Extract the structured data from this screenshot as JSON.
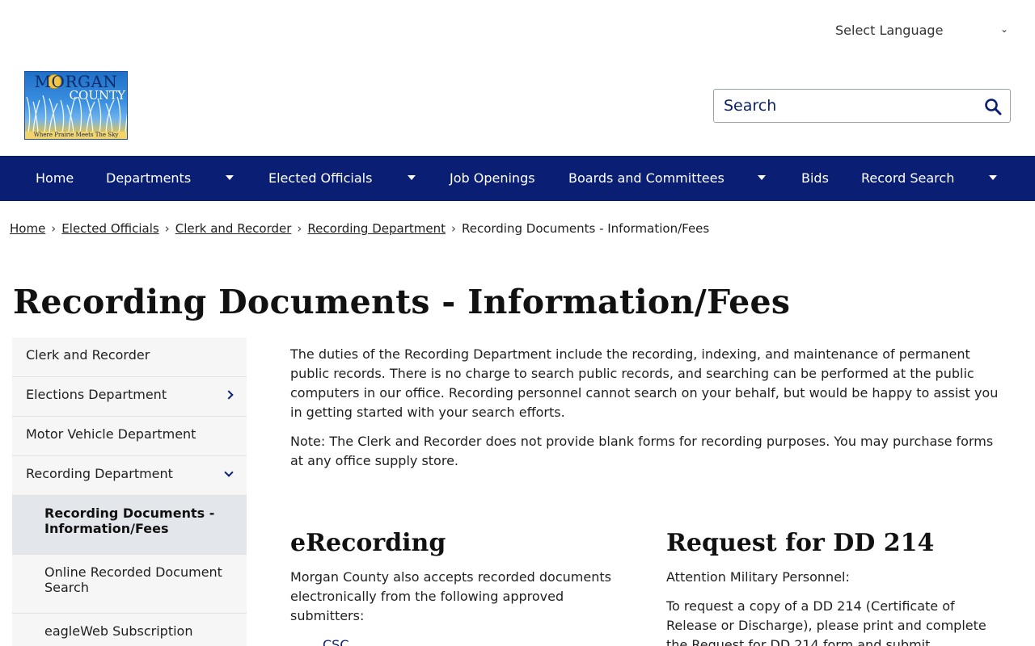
{
  "language_select": {
    "label": "Select Language"
  },
  "logo": {
    "line1": "MORGAN",
    "line2": "COUNTY",
    "tagline": "Where Prairie Meets The Sky"
  },
  "search": {
    "placeholder": "Search"
  },
  "nav": {
    "items": [
      {
        "label": "Home"
      },
      {
        "label": "Departments"
      },
      {
        "label": "Elected Officials"
      },
      {
        "label": "Job Openings"
      },
      {
        "label": "Boards and Committees"
      },
      {
        "label": "Bids"
      },
      {
        "label": "Record Search"
      }
    ]
  },
  "breadcrumb": {
    "items": [
      "Home",
      "Elected Officials",
      "Clerk and Recorder",
      "Recording Department"
    ],
    "current": "Recording Documents - Information/Fees"
  },
  "page": {
    "title": "Recording Documents - Information/Fees"
  },
  "sidebar": {
    "items": [
      {
        "label": "Clerk and Recorder"
      },
      {
        "label": "Elections Department"
      },
      {
        "label": "Motor Vehicle Department"
      },
      {
        "label": "Recording Department"
      },
      {
        "label": "Recording Documents - Information/Fees"
      },
      {
        "label": "Online Recorded Document Search"
      },
      {
        "label": "eagleWeb Subscription"
      }
    ]
  },
  "main": {
    "intro": "The duties of the Recording Department include the recording, indexing, and maintenance of permanent public records. There is no charge to search public records, and searching can be performed at the public computers in our office. Recording personnel cannot search on your behalf, but would be happy to assist you in getting started with your search efforts.",
    "note": "Note: The Clerk and Recorder does not provide blank forms for recording purposes. You may purchase forms at any office supply store."
  },
  "erecording": {
    "heading": "eRecording",
    "text": "Morgan County also accepts recorded documents electronically from the following approved submitters:",
    "first_link": "CSC"
  },
  "dd214": {
    "heading": "Request for DD 214",
    "attention": "Attention Military Personnel:",
    "text": "To request a copy of a DD 214 (Certificate of Release or Discharge), please print and complete the Request for DD 214 form and submit"
  }
}
